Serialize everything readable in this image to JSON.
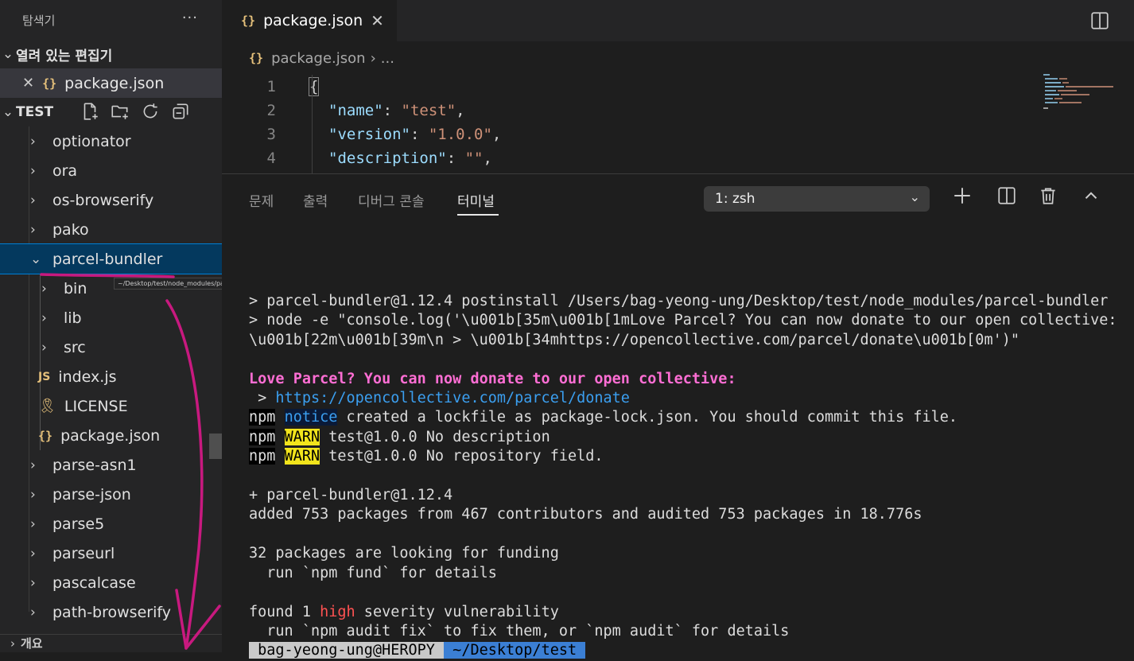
{
  "explorer": {
    "title": "탐색기",
    "more": "···",
    "open_editors": {
      "label": "열려 있는 편집기",
      "items": [
        {
          "close": "✕",
          "icon": "{}",
          "name": "package.json"
        }
      ]
    },
    "folder": {
      "label": "TEST"
    },
    "tree": [
      {
        "name": "optionator",
        "chev": "›"
      },
      {
        "name": "ora",
        "chev": "›"
      },
      {
        "name": "os-browserify",
        "chev": "›"
      },
      {
        "name": "pako",
        "chev": "›"
      },
      {
        "name": "parcel-bundler",
        "chev": "⌄"
      },
      {
        "name": "bin",
        "chev": "›"
      },
      {
        "name": "lib",
        "chev": "›"
      },
      {
        "name": "src",
        "chev": "›"
      },
      {
        "name": "index.js",
        "icon": "JS"
      },
      {
        "name": "LICENSE",
        "icon": "🎗"
      },
      {
        "name": "package.json",
        "icon": "{}"
      },
      {
        "name": "parse-asn1",
        "chev": "›"
      },
      {
        "name": "parse-json",
        "chev": "›"
      },
      {
        "name": "parse5",
        "chev": "›"
      },
      {
        "name": "parseurl",
        "chev": "›"
      },
      {
        "name": "pascalcase",
        "chev": "›"
      },
      {
        "name": "path-browserify",
        "chev": "›"
      }
    ],
    "tooltip": "~/Desktop/test/node_modules/parcel-bundler",
    "bottom_section": "개요"
  },
  "editor": {
    "tab": {
      "icon": "{}",
      "label": "package.json",
      "close": "✕"
    },
    "breadcrumb": {
      "icon": "{}",
      "file": "package.json",
      "sep": "›",
      "rest": "..."
    },
    "lines": [
      {
        "n": "1",
        "key": "",
        "val": "",
        "raw": "{"
      },
      {
        "n": "2",
        "key": "\"name\"",
        "val": "\"test\""
      },
      {
        "n": "3",
        "key": "\"version\"",
        "val": "\"1.0.0\""
      },
      {
        "n": "4",
        "key": "\"description\"",
        "val": "\"\""
      }
    ]
  },
  "panel": {
    "tabs": [
      "문제",
      "출력",
      "디버그 콘솔",
      "터미널"
    ],
    "active_tab": "터미널",
    "terminal_select": "1: zsh",
    "terminal": {
      "l1": "> parcel-bundler@1.12.4 postinstall /Users/bag-yeong-ung/Desktop/test/node_modules/parcel-bundler",
      "l2": "> node -e \"console.log('\\u001b[35m\\u001b[1mLove Parcel? You can now donate to our open collective:",
      "l3": "\\u001b[22m\\u001b[39m\\n > \\u001b[34mhttps://opencollective.com/parcel/donate\\u001b[0m')\"",
      "love": "Love Parcel? You can now donate to our open collective:",
      "donate_prefix": " > ",
      "donate_url": "https://opencollective.com/parcel/donate",
      "npm": "npm",
      "notice": "notice",
      "notice_text": " created a lockfile as package-lock.json. You should commit this file.",
      "warn": "WARN",
      "warn1": " test@1.0.0 No description",
      "warn2": " test@1.0.0 No repository field.",
      "added1": "+ parcel-bundler@1.12.4",
      "added2": "added 753 packages from 467 contributors and audited 753 packages in 18.776s",
      "fund1": "32 packages are looking for funding",
      "fund2": "  run `npm fund` for details",
      "vuln_pre": "found 1 ",
      "vuln_high": "high",
      "vuln_post": " severity vulnerability",
      "vuln2": "  run `npm audit fix` to fix them, or `npm audit` for details",
      "prompt_user": " bag-yeong-ung@HEROPY ",
      "prompt_path": " ~/Desktop/test ",
      "prompt_cursor": " "
    }
  },
  "colors": {
    "selection": "#04395e",
    "accent": "#007fd4",
    "annotation": "#c8197f"
  }
}
